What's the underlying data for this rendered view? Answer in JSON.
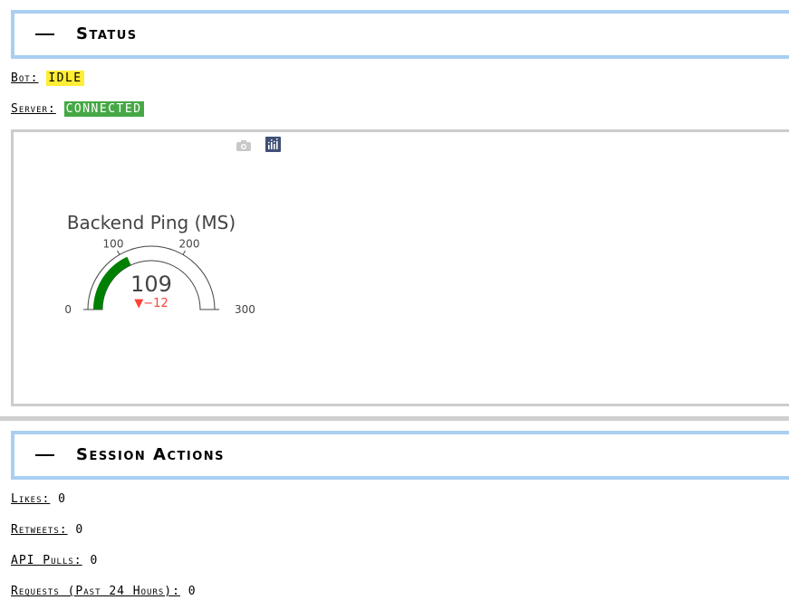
{
  "status_panel": {
    "title": "Status",
    "bot_label": "Bot:",
    "bot_value": "IDLE",
    "server_label": "Server:",
    "server_value": "CONNECTED"
  },
  "gauge": {
    "title": "Backend Ping (MS)",
    "value": 109,
    "value_text": "109",
    "delta_text": "▼−12",
    "min": 0,
    "max": 300,
    "ticks": [
      "0",
      "100",
      "200",
      "300"
    ],
    "bar_color": "#008000",
    "delta_color": "#ff4136",
    "toolbar": {
      "camera": "camera-icon",
      "plotly": "plotly-logo-icon"
    }
  },
  "session_panel": {
    "title": "Session Actions",
    "likes_label": "Likes:",
    "likes_value": "0",
    "retweets_label": "Retweets:",
    "retweets_value": "0",
    "api_pulls_label": "API Pulls:",
    "api_pulls_value": "0",
    "requests_label": "Requests (Past 24 Hours):",
    "requests_value": "0"
  }
}
